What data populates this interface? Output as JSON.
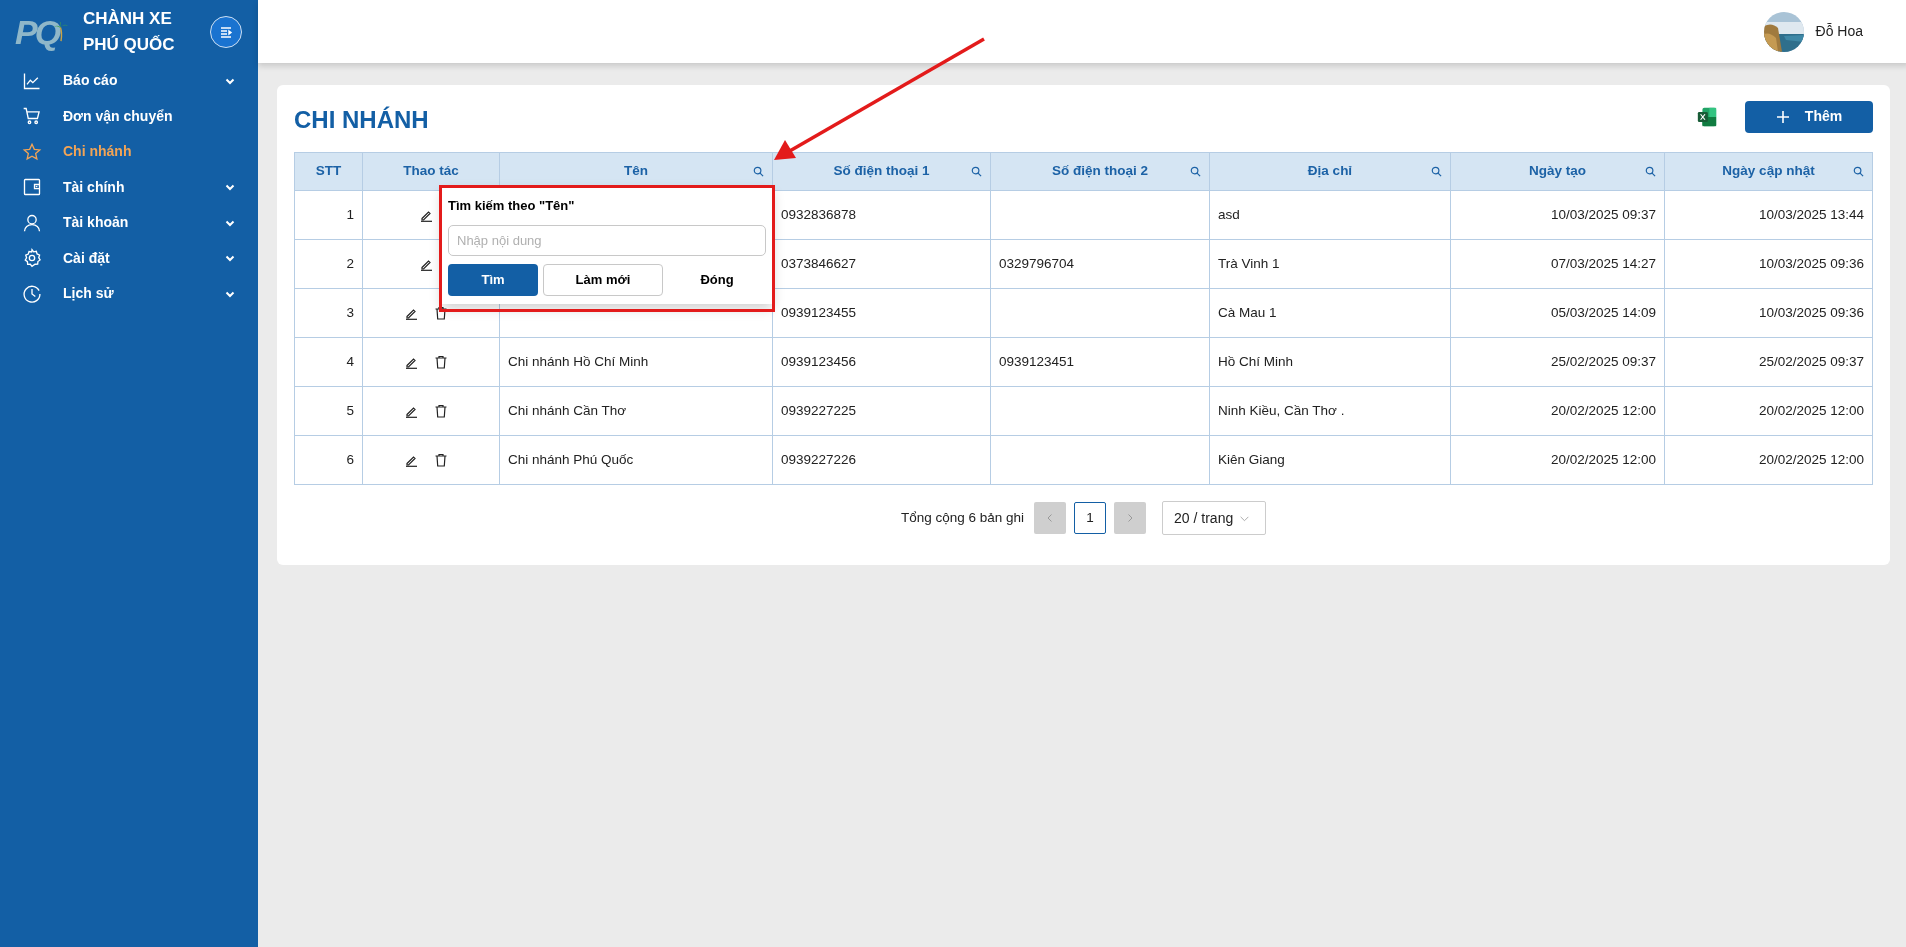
{
  "sidebar": {
    "logo_text": "PQ",
    "brand": [
      "CHÀNH XE",
      "PHÚ QUỐC"
    ],
    "items": [
      {
        "label": "Báo cáo",
        "expandable": true,
        "selected": false
      },
      {
        "label": "Đơn vận chuyển",
        "expandable": false,
        "selected": false
      },
      {
        "label": "Chi nhánh",
        "expandable": false,
        "selected": true
      },
      {
        "label": "Tài chính",
        "expandable": true,
        "selected": false
      },
      {
        "label": "Tài khoản",
        "expandable": true,
        "selected": false
      },
      {
        "label": "Cài đặt",
        "expandable": true,
        "selected": false
      },
      {
        "label": "Lịch sử",
        "expandable": true,
        "selected": false
      }
    ]
  },
  "header": {
    "user_name": "Đỗ Hoa"
  },
  "page": {
    "title": "CHI NHÁNH",
    "add_button": "Thêm"
  },
  "table": {
    "columns": [
      {
        "label": "STT",
        "searchable": false
      },
      {
        "label": "Thao tác",
        "searchable": false
      },
      {
        "label": "Tên",
        "searchable": true
      },
      {
        "label": "Số điện thoại 1",
        "searchable": true
      },
      {
        "label": "Số điện thoại 2",
        "searchable": true
      },
      {
        "label": "Địa chỉ",
        "searchable": true
      },
      {
        "label": "Ngày tạo",
        "searchable": true
      },
      {
        "label": "Ngày cập nhật",
        "searchable": true
      }
    ],
    "rows": [
      {
        "stt": "1",
        "actions": [
          {
            "kind": "edit"
          }
        ],
        "phone1": "0932836878",
        "address": "asd",
        "created": "10/03/2025 09:37",
        "updated": "10/03/2025 13:44"
      },
      {
        "stt": "2",
        "actions": [
          {
            "kind": "edit"
          }
        ],
        "phone1": "0373846627",
        "phone2": "0329796704",
        "address": "Trà Vinh 1",
        "created": "07/03/2025 14:27",
        "updated": "10/03/2025 09:36"
      },
      {
        "stt": "3",
        "actions": [
          {
            "kind": "edit"
          },
          {
            "kind": "delete"
          }
        ],
        "phone1": "0939123455",
        "address": "Cà Mau 1",
        "created": "05/03/2025 14:09",
        "updated": "10/03/2025 09:36"
      },
      {
        "stt": "4",
        "actions": [
          {
            "kind": "edit"
          },
          {
            "kind": "delete"
          }
        ],
        "name": "Chi nhánh Hồ Chí Minh",
        "phone1": "0939123456",
        "phone2": "0939123451",
        "address": "Hồ Chí Minh",
        "created": "25/02/2025 09:37",
        "updated": "25/02/2025 09:37"
      },
      {
        "stt": "5",
        "actions": [
          {
            "kind": "edit"
          },
          {
            "kind": "delete"
          }
        ],
        "name": "Chi nhánh Cần Thơ",
        "phone1": "0939227225",
        "address": "Ninh Kiều, Cần Thơ .",
        "created": "20/02/2025 12:00",
        "updated": "20/02/2025 12:00"
      },
      {
        "stt": "6",
        "actions": [
          {
            "kind": "edit"
          },
          {
            "kind": "delete"
          }
        ],
        "name": "Chi nhánh Phú Quốc",
        "phone1": "0939227226",
        "address": "Kiên Giang",
        "created": "20/02/2025 12:00",
        "updated": "20/02/2025 12:00"
      }
    ]
  },
  "search_popup": {
    "title": "Tìm kiếm theo \"Tên\"",
    "placeholder": "Nhập nội dung",
    "buttons": [
      {
        "label": "Tìm",
        "kind": "primary"
      },
      {
        "label": "Làm mới",
        "kind": "default"
      },
      {
        "label": "Đóng",
        "kind": "text"
      }
    ]
  },
  "pagination": {
    "total": "Tổng cộng 6 bản ghi",
    "prev_disabled": true,
    "pages": [
      {
        "label": "1",
        "selected": true
      }
    ],
    "next_disabled": true,
    "page_size": "20 / trang"
  },
  "annotations": {
    "arrow": true,
    "highlight_frame": true
  }
}
